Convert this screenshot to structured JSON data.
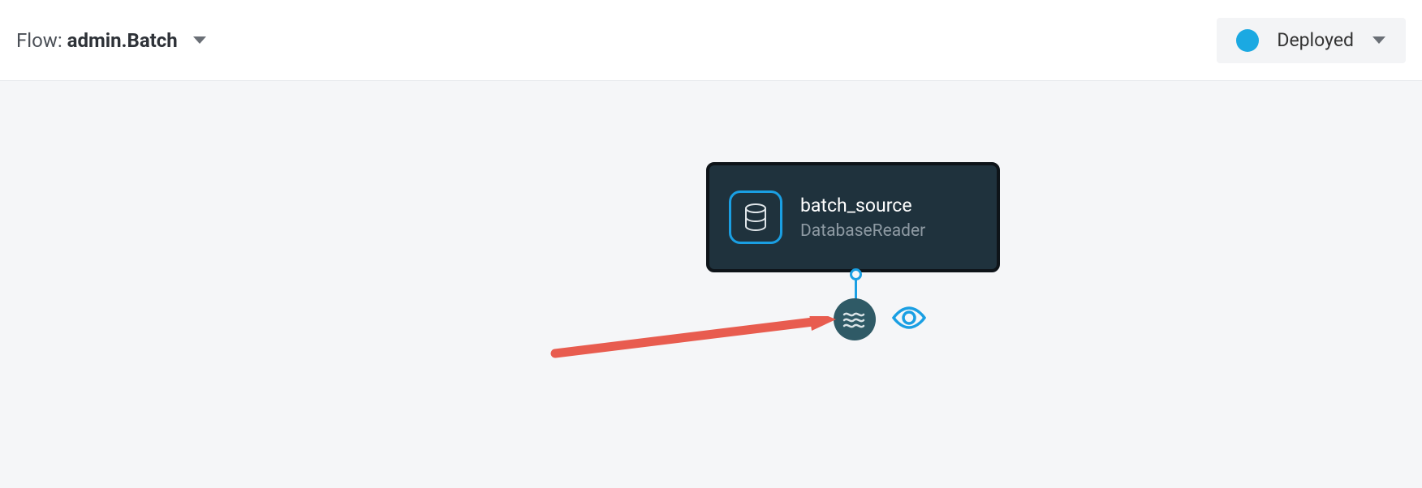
{
  "header": {
    "flow_prefix": "Flow: ",
    "flow_name": "admin.Batch",
    "status_label": "Deployed",
    "status_color": "#1ba9e2"
  },
  "node": {
    "title": "batch_source",
    "subtitle": "DatabaseReader",
    "icon": "database"
  },
  "icons": {
    "stream": "wave",
    "preview": "eye"
  }
}
